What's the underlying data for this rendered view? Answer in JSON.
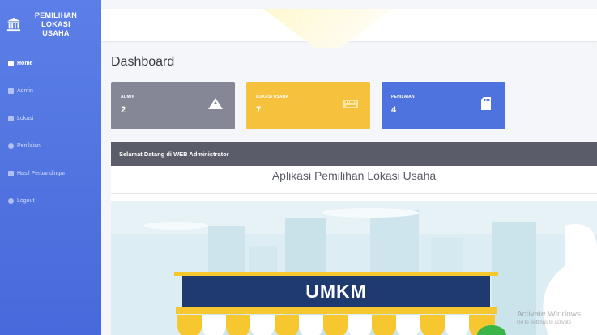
{
  "sidebar": {
    "brand": {
      "line1": "PEMILIHAN",
      "line2": "LOKASI",
      "line3": "USAHA",
      "icon": "bank-icon"
    },
    "items": [
      {
        "label": "Home",
        "icon": "home-icon",
        "active": true
      },
      {
        "label": "Admin",
        "icon": "user-icon",
        "active": false
      },
      {
        "label": "Lokasi",
        "icon": "map-icon",
        "active": false
      },
      {
        "label": "Penilaian",
        "icon": "star-icon",
        "active": false
      },
      {
        "label": "Hasil Perbandingan",
        "icon": "chart-icon",
        "active": false
      },
      {
        "label": "Logout",
        "icon": "logout-icon",
        "active": false
      }
    ]
  },
  "page": {
    "title": "Dashboard"
  },
  "cards": [
    {
      "label": "ADMIN",
      "value": "2",
      "icon": "mountain-icon",
      "color": "#858796"
    },
    {
      "label": "LOKASI USAHA",
      "value": "7",
      "icon": "keyboard-icon",
      "color": "#f6c23e"
    },
    {
      "label": "PENILAIAN",
      "value": "4",
      "icon": "sd-card-icon",
      "color": "#4e73df"
    }
  ],
  "welcome": {
    "header": "Selamat Datang di WEB Administrator",
    "title": "Aplikasi Pemilihan Lokasi Usaha",
    "sign_text": "UMKM"
  },
  "watermark": {
    "line1": "Activate Windows",
    "line2": "Go to Settings to activate"
  },
  "colors": {
    "sidebar": "#4e73df",
    "header_dark": "#5a5c69",
    "sign": "#1e3a6e",
    "awning_yellow": "#f7c72f"
  }
}
